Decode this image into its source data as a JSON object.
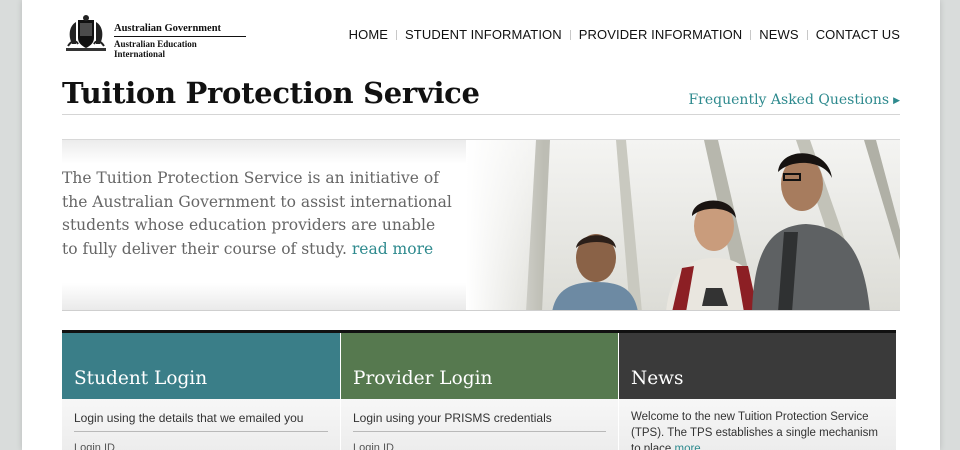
{
  "header": {
    "org_line1": "Australian Government",
    "org_line2": "Australian Education International",
    "nav": [
      "HOME",
      "STUDENT INFORMATION",
      "PROVIDER INFORMATION",
      "NEWS",
      "CONTACT US"
    ]
  },
  "title": "Tuition Protection Service",
  "faq_link": "Frequently Asked Questions",
  "hero": {
    "text": "The Tuition Protection Service is an initiative of the Australian Government to assist international students whose education providers are unable to fully deliver their course of study.",
    "read_more": "read more"
  },
  "boxes": {
    "student": {
      "title": "Student Login",
      "subtitle": "Login using the details that we emailed you",
      "field_label": "Login ID",
      "color": "#3a7e88"
    },
    "provider": {
      "title": "Provider Login",
      "subtitle": "Login using your PRISMS credentials",
      "field_label": "Login ID",
      "color": "#56794f"
    },
    "news": {
      "title": "News",
      "text": "Welcome to the new Tuition Protection Service (TPS). The TPS establishes a single mechanism to place",
      "more": "more",
      "color": "#3a3a3a"
    }
  },
  "colors": {
    "accent": "#2e8a8e",
    "title": "#111111"
  }
}
